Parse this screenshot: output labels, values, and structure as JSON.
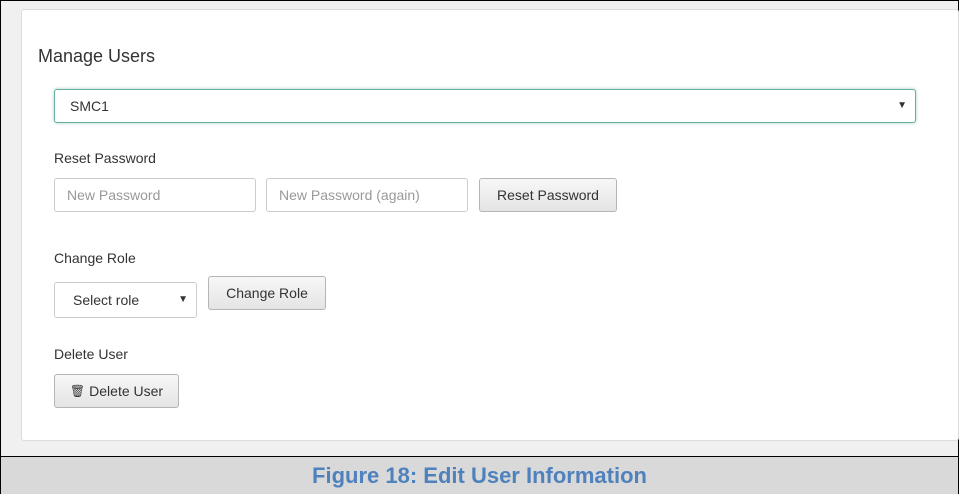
{
  "manage": {
    "title": "Manage Users",
    "selected_user": "SMC1"
  },
  "reset_password": {
    "label": "Reset Password",
    "new_placeholder": "New Password",
    "again_placeholder": "New Password (again)",
    "button": "Reset Password"
  },
  "change_role": {
    "label": "Change Role",
    "selected_role": "Select role",
    "button": "Change Role"
  },
  "delete_user": {
    "label": "Delete User",
    "button": "Delete User",
    "icon": "trash-icon"
  },
  "caption": "Figure 18: Edit User Information",
  "colors": {
    "caption": "#4f81bd",
    "focus_border": "#66afa0",
    "caption_bar": "#d9d9d9"
  }
}
